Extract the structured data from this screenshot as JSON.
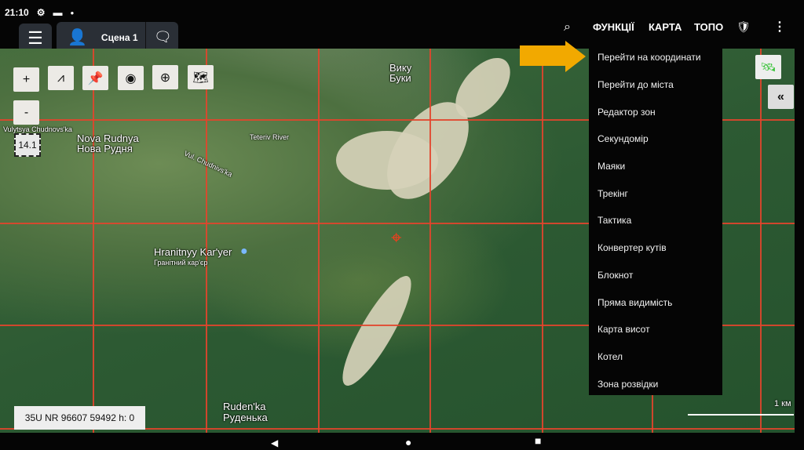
{
  "status_bar": {
    "time": "21:10"
  },
  "top_bar": {
    "scene_label": "Сцена 1",
    "nav": [
      "ФУНКЦІЇ",
      "КАРТА",
      "ТОПО"
    ]
  },
  "menu": {
    "items": [
      "Перейти на координати",
      "Перейти до міста",
      "Редактор зон",
      "Секундомір",
      "Маяки",
      "Трекінг",
      "Тактика",
      "Конвертер кутів",
      "Блокнот",
      "Пряма видимість",
      "Карта висот",
      "Котел",
      "Зона розвідки"
    ]
  },
  "map": {
    "zoom_level": "14.1",
    "zoom_in": "+",
    "zoom_out": "-",
    "labels": {
      "nova_rudnya_lat": "Nova Rudnya",
      "nova_rudnya": "Нова Рудня",
      "vyku_lat": "Вику",
      "buky": "Буки",
      "hranitnyy_lat": "Hranitnyy Kar'yer",
      "hranitnyy": "Гранітний кар'єр",
      "rudenka_lat": "Ruden'ka",
      "rudenka": "Руденька",
      "street": "Vulytsya Chudnovs'ka",
      "street2": "Vul. Chudnivs'ka",
      "river": "Teteriv River"
    },
    "coordinates": "35U NR 96607 59492 h: 0",
    "scale": "1 км",
    "collapse": "«"
  },
  "colors": {
    "grid": "#e2452c",
    "arrow": "#f2a900",
    "satellite": "#3cc43c"
  }
}
